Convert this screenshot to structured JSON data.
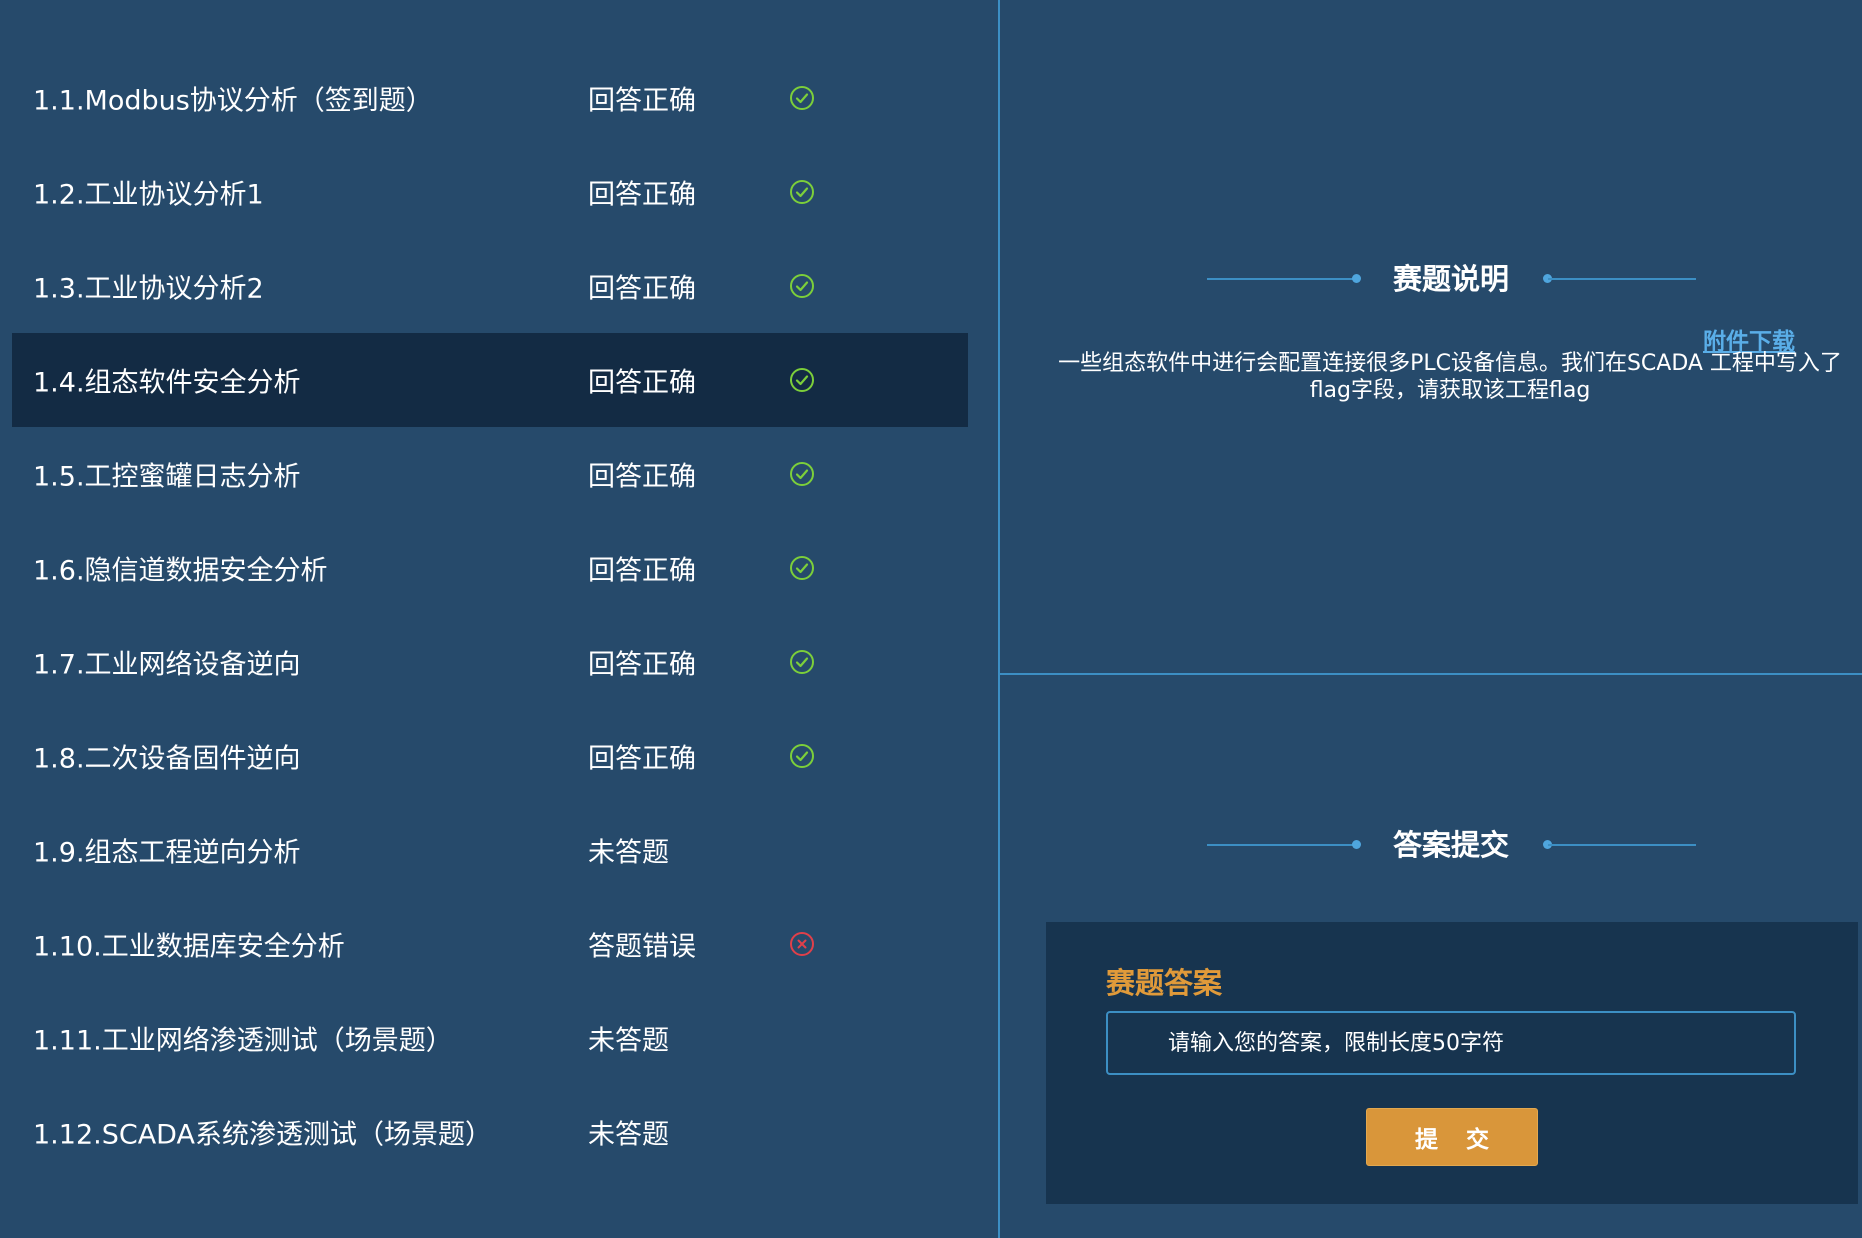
{
  "questions": [
    {
      "title": "1.1.Modbus协议分析（签到题）",
      "status": "回答正确",
      "icon": "check-circle-icon"
    },
    {
      "title": "1.2.工业协议分析1",
      "status": "回答正确",
      "icon": "check-circle-icon"
    },
    {
      "title": "1.3.工业协议分析2",
      "status": "回答正确",
      "icon": "check-circle-icon"
    },
    {
      "title": "1.4.组态软件安全分析",
      "status": "回答正确",
      "icon": "check-circle-icon"
    },
    {
      "title": "1.5.工控蜜罐日志分析",
      "status": "回答正确",
      "icon": "check-circle-icon"
    },
    {
      "title": "1.6.隐信道数据安全分析",
      "status": "回答正确",
      "icon": "check-circle-icon"
    },
    {
      "title": "1.7.工业网络设备逆向",
      "status": "回答正确",
      "icon": "check-circle-icon"
    },
    {
      "title": "1.8.二次设备固件逆向",
      "status": "回答正确",
      "icon": "check-circle-icon"
    },
    {
      "title": "1.9.组态工程逆向分析",
      "status": "未答题",
      "icon": ""
    },
    {
      "title": "1.10.工业数据库安全分析",
      "status": "答题错误",
      "icon": "x-circle-icon"
    },
    {
      "title": "1.11.工业网络渗透测试（场景题）",
      "status": "未答题",
      "icon": ""
    },
    {
      "title": "1.12.SCADA系统渗透测试（场景题）",
      "status": "未答题",
      "icon": ""
    }
  ],
  "selected_question_index": 3,
  "description": {
    "header": "赛题说明",
    "attachment_link": "附件下载",
    "text": "一些组态软件中进行会配置连接很多PLC设备信息。我们在SCADA 工程中写入了flag字段，请获取该工程flag"
  },
  "answer": {
    "header": "答案提交",
    "label": "赛题答案",
    "placeholder": "请输入您的答案，限制长度50字符",
    "value": "",
    "submit_label": "提 交"
  },
  "colors": {
    "background": "#264a6b",
    "selected_row": "#132b44",
    "answer_panel": "#17344f",
    "divider": "#3c8fc4",
    "success": "#7ccf3a",
    "error": "#e0404a",
    "accent_orange": "#d9963a",
    "link": "#5aaee8"
  }
}
